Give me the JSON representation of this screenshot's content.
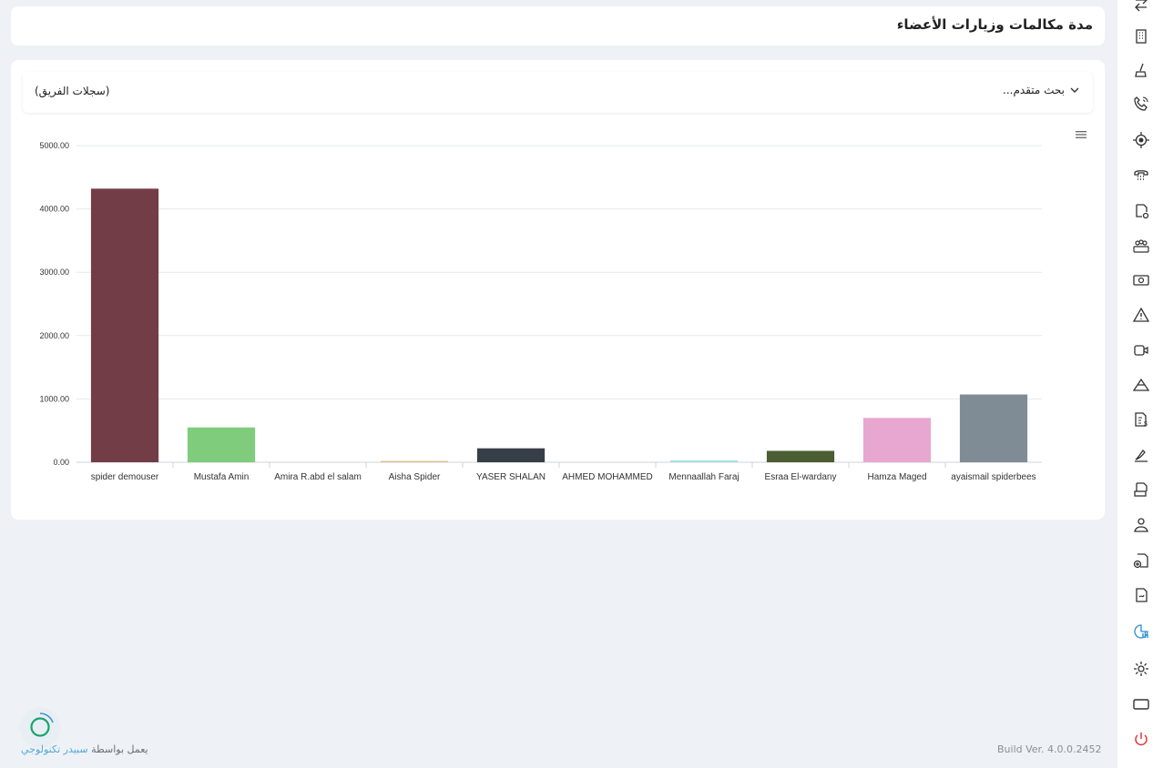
{
  "page": {
    "title": "مدة مكالمات وزيارات الأعضاء"
  },
  "filters": {
    "advanced_search": "بحث متقدم...",
    "team_records": "(سجلات الفريق)"
  },
  "chart_data": {
    "type": "bar",
    "categories": [
      "spider demouser",
      "Mustafa Amin",
      "Amira R.abd el salam",
      "Aisha Spider",
      "YASER SHALAN",
      "AHMED MOHAMMED",
      "Mennaallah Faraj",
      "Esraa El-wardany",
      "Hamza Maged",
      "ayaismail spiderbees"
    ],
    "values": [
      4320,
      550,
      0,
      20,
      220,
      0,
      30,
      180,
      700,
      1070
    ],
    "colors": [
      "#733d47",
      "#7fcd7c",
      "#cccccc",
      "#d8c28a",
      "#363f48",
      "#999999",
      "#a8e0e4",
      "#4a5d33",
      "#e8a7d1",
      "#7f8c95"
    ],
    "ylim": [
      0,
      5000
    ],
    "yticks": [
      "0.00",
      "1000.00",
      "2000.00",
      "3000.00",
      "4000.00",
      "5000.00"
    ],
    "grid": true
  },
  "footer": {
    "build": "Build Ver. 4.0.0.2452",
    "powered_by": "يعمل بواسطة",
    "brand": "سبيدر تكنولوجي"
  },
  "sidebar": {
    "icons": [
      "swap-icon",
      "building-icon",
      "broom-icon",
      "phone-call-icon",
      "location-target-icon",
      "telephone-icon",
      "file-settings-icon",
      "team-icon",
      "money-icon",
      "warning-icon",
      "video-icon",
      "mountain-icon",
      "invoice-dollar-icon",
      "signature-icon",
      "document-print-icon",
      "user-icon",
      "file-add-icon",
      "file-sign-icon",
      "report-chart-icon",
      "settings-icon",
      "screen-icon",
      "power-icon"
    ],
    "active_color": "#2b8fd6",
    "power_color": "#e0353c"
  }
}
